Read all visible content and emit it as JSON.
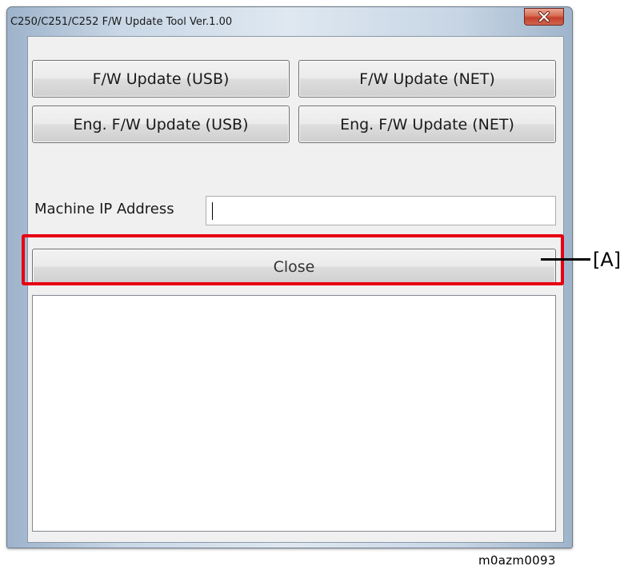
{
  "window": {
    "title": "C250/C251/C252 F/W Update Tool Ver.1.00",
    "close_icon": "close-icon"
  },
  "buttons": {
    "fw_update_usb": "F/W Update (USB)",
    "fw_update_net": "F/W Update (NET)",
    "eng_fw_update_usb": "Eng. F/W Update (USB)",
    "eng_fw_update_net": "Eng. F/W Update (NET)",
    "close": "Close"
  },
  "ip_address": {
    "label": "Machine IP Address",
    "value": ""
  },
  "log": {
    "content": ""
  },
  "annotation": {
    "callout_label": "[A]",
    "highlight_color": "#e60012",
    "figure_id": "m0azm0093"
  }
}
